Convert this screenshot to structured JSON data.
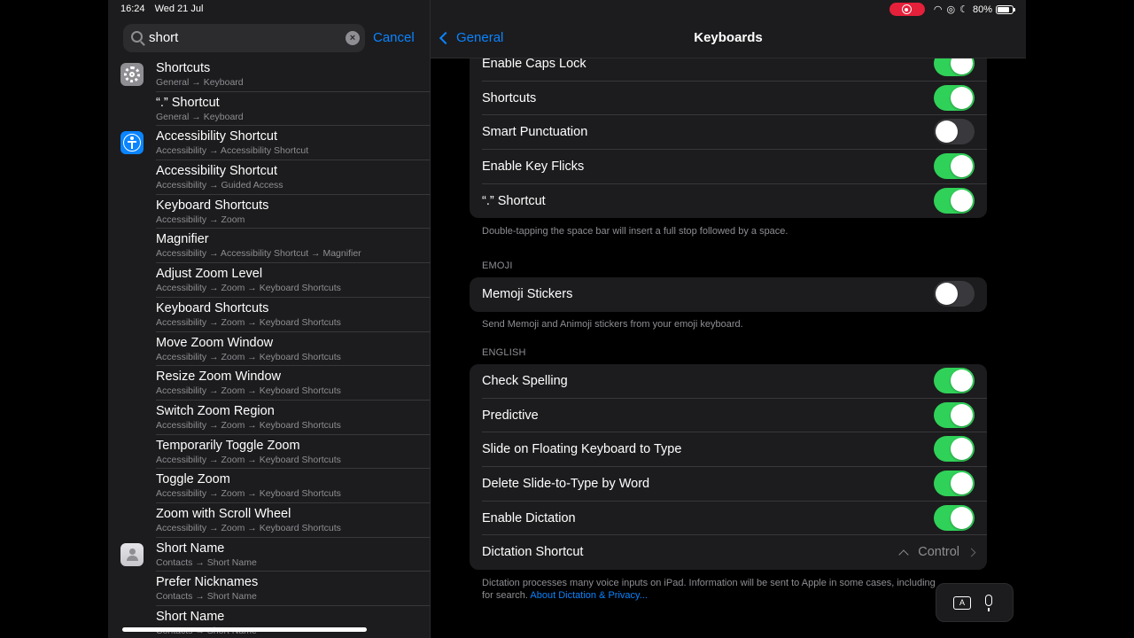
{
  "status_bar": {
    "time": "16:24",
    "date": "Wed 21 Jul",
    "battery": "80%",
    "battery_level": 0.8
  },
  "search": {
    "query": "short",
    "cancel_label": "Cancel"
  },
  "results": [
    {
      "title": "Shortcuts",
      "path": "General → Keyboard",
      "icon": "settings-gear-icon"
    },
    {
      "title": "“.” Shortcut",
      "path": "General → Keyboard",
      "icon": ""
    },
    {
      "title": "Accessibility Shortcut",
      "path": "Accessibility → Accessibility Shortcut",
      "icon": "accessibility-icon"
    },
    {
      "title": "Accessibility Shortcut",
      "path": "Accessibility → Guided Access",
      "icon": ""
    },
    {
      "title": "Keyboard Shortcuts",
      "path": "Accessibility → Zoom",
      "icon": ""
    },
    {
      "title": "Magnifier",
      "path": "Accessibility → Accessibility Shortcut → Magnifier",
      "icon": ""
    },
    {
      "title": "Adjust Zoom Level",
      "path": "Accessibility → Zoom → Keyboard Shortcuts",
      "icon": ""
    },
    {
      "title": "Keyboard Shortcuts",
      "path": "Accessibility → Zoom → Keyboard Shortcuts",
      "icon": ""
    },
    {
      "title": "Move Zoom Window",
      "path": "Accessibility → Zoom → Keyboard Shortcuts",
      "icon": ""
    },
    {
      "title": "Resize Zoom Window",
      "path": "Accessibility → Zoom → Keyboard Shortcuts",
      "icon": ""
    },
    {
      "title": "Switch Zoom Region",
      "path": "Accessibility → Zoom → Keyboard Shortcuts",
      "icon": ""
    },
    {
      "title": "Temporarily Toggle Zoom",
      "path": "Accessibility → Zoom → Keyboard Shortcuts",
      "icon": ""
    },
    {
      "title": "Toggle Zoom",
      "path": "Accessibility → Zoom → Keyboard Shortcuts",
      "icon": ""
    },
    {
      "title": "Zoom with Scroll Wheel",
      "path": "Accessibility → Zoom → Keyboard Shortcuts",
      "icon": ""
    },
    {
      "title": "Short Name",
      "path": "Contacts → Short Name",
      "icon": "contacts-icon"
    },
    {
      "title": "Prefer Nicknames",
      "path": "Contacts → Short Name",
      "icon": ""
    },
    {
      "title": "Short Name",
      "path": "Contacts → Short Name",
      "icon": ""
    }
  ],
  "nav": {
    "back_label": "General",
    "title": "Keyboards"
  },
  "group1": {
    "rows": [
      {
        "label": "Enable Caps Lock",
        "on": true
      },
      {
        "label": "Shortcuts",
        "on": true
      },
      {
        "label": "Smart Punctuation",
        "on": false
      },
      {
        "label": "Enable Key Flicks",
        "on": true
      },
      {
        "label": "“.” Shortcut",
        "on": true
      }
    ],
    "footer": "Double-tapping the space bar will insert a full stop followed by a space."
  },
  "emoji": {
    "header": "EMOJI",
    "rows": [
      {
        "label": "Memoji Stickers",
        "on": false
      }
    ],
    "footer": "Send Memoji and Animoji stickers from your emoji keyboard."
  },
  "english": {
    "header": "ENGLISH",
    "rows": [
      {
        "label": "Check Spelling",
        "on": true
      },
      {
        "label": "Predictive",
        "on": true
      },
      {
        "label": "Slide on Floating Keyboard to Type",
        "on": true
      },
      {
        "label": "Delete Slide-to-Type by Word",
        "on": true
      },
      {
        "label": "Enable Dictation",
        "on": true
      }
    ],
    "dictation_shortcut": {
      "label": "Dictation Shortcut",
      "value": "Control"
    },
    "footer": "Dictation processes many voice inputs on iPad. Information will be sent to Apple in some cases, including for search.",
    "footer_link": "About Dictation & Privacy..."
  },
  "keyboard_button": {
    "key_glyph": "A"
  },
  "colors": {
    "accent": "#0a84ff",
    "toggle_on": "#30d158",
    "record": "#e5203a"
  }
}
